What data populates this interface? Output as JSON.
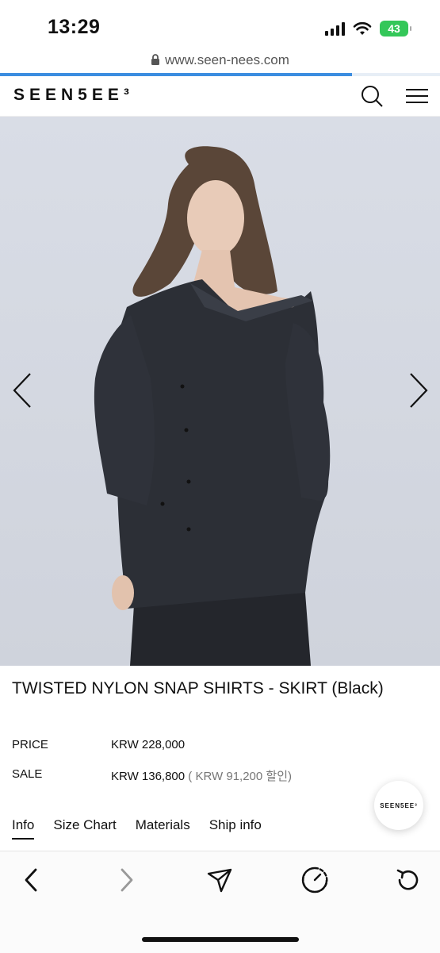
{
  "status_bar": {
    "time": "13:29",
    "battery": "43"
  },
  "browser": {
    "url": "www.seen-nees.com",
    "load_progress": 0.8
  },
  "site": {
    "logo": "SEEN5EE³",
    "floating_logo": "SEEN5EE³"
  },
  "product": {
    "title": "TWISTED NYLON SNAP SHIRTS - SKIRT (Black)",
    "price_label": "PRICE",
    "price_value": "KRW 228,000",
    "sale_label": "SALE",
    "sale_value": "KRW 136,800",
    "sale_discount": " ( KRW 91,200 할인)"
  },
  "tabs": [
    {
      "label": "Info",
      "active": true
    },
    {
      "label": "Size Chart"
    },
    {
      "label": "Materials"
    },
    {
      "label": "Ship info"
    }
  ],
  "icons": {
    "search": "search-icon",
    "menu": "hamburger-menu-icon",
    "prev_image": "chevron-left-icon",
    "next_image": "chevron-right-icon",
    "back": "back-icon",
    "forward": "forward-icon",
    "share": "send-icon",
    "speed": "gauge-icon",
    "reload": "reload-icon"
  }
}
